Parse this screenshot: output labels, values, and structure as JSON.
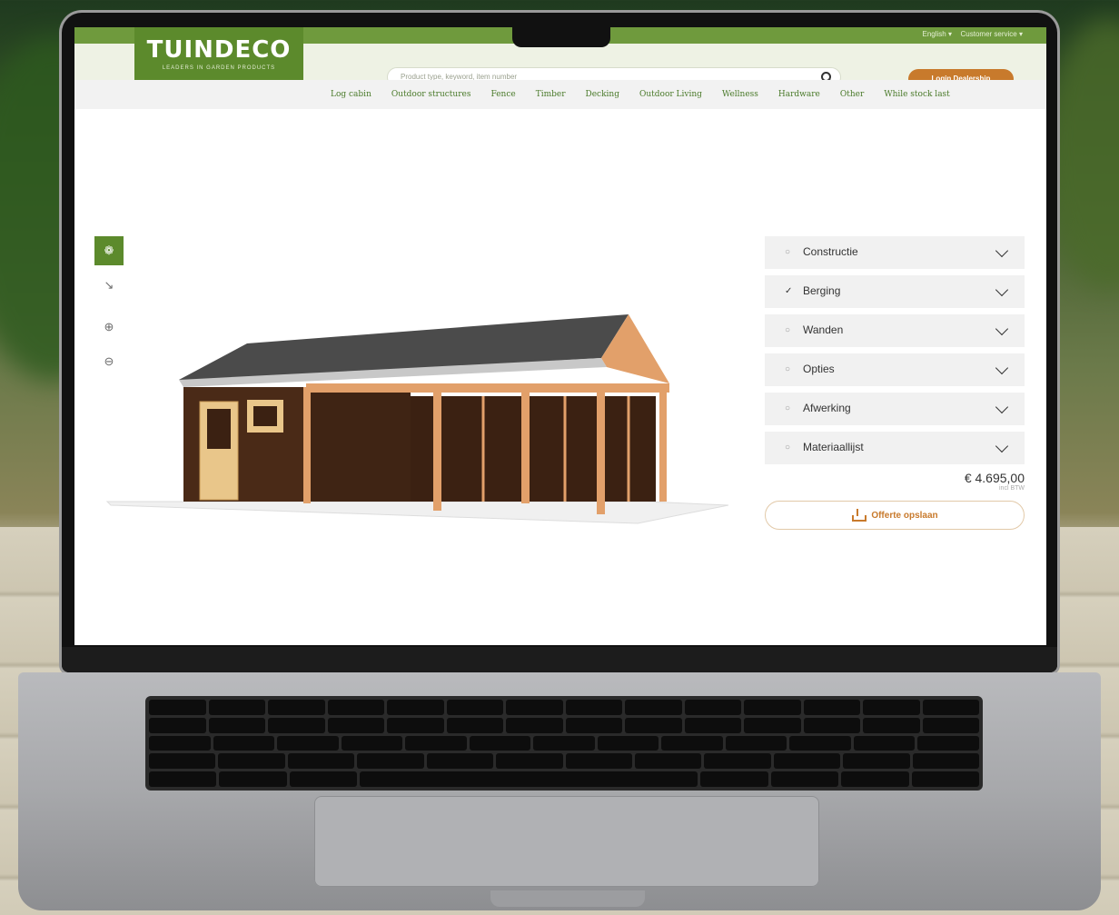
{
  "site": {
    "logo_title": "TUINDECO",
    "logo_tagline": "LEADERS IN GARDEN PRODUCTS",
    "language": "English ▾",
    "account": "Customer service ▾",
    "search_placeholder": "Product type, keyword, item number",
    "login_label": "Login Dealership"
  },
  "nav": {
    "items": [
      "Log cabin",
      "Outdoor structures",
      "Fence",
      "Timber",
      "Decking",
      "Outdoor Living",
      "Wellness",
      "Hardware",
      "Other",
      "While stock last"
    ]
  },
  "tools": {
    "icons": [
      "cube-icon",
      "dimensions-icon",
      "zoom-in-icon",
      "zoom-out-icon"
    ]
  },
  "config": {
    "sections": [
      {
        "label": "Constructie",
        "status_icon": "circle-icon"
      },
      {
        "label": "Berging",
        "status_icon": "check-icon"
      },
      {
        "label": "Wanden",
        "status_icon": "circle-icon"
      },
      {
        "label": "Opties",
        "status_icon": "circle-icon"
      },
      {
        "label": "Afwerking",
        "status_icon": "circle-icon"
      },
      {
        "label": "Materiaallijst",
        "status_icon": "circle-icon"
      }
    ],
    "price": "€ 4.695,00",
    "price_note": "incl BTW",
    "quote_label": "Offerte opslaan"
  },
  "colors": {
    "brand_green": "#5c8a2c",
    "accent_orange": "#c87a2c"
  }
}
